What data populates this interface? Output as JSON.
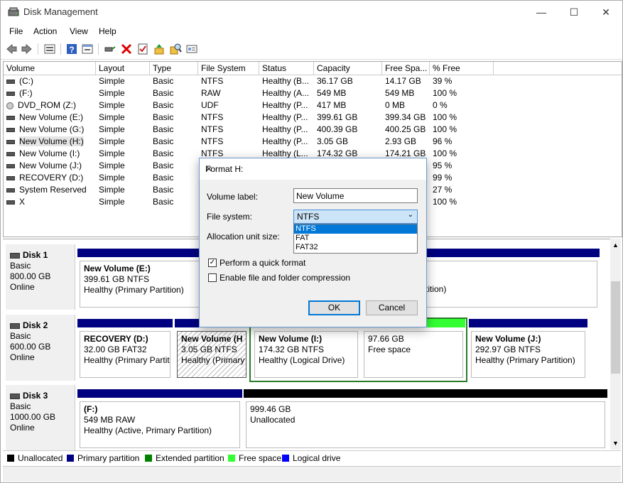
{
  "window": {
    "title": "Disk Management"
  },
  "menu": [
    "File",
    "Action",
    "View",
    "Help"
  ],
  "toolbar_icons": [
    "back-icon",
    "forward-icon",
    "disk-list-icon",
    "help-icon",
    "properties-icon",
    "connect-icon",
    "delete-icon",
    "check-icon",
    "import-icon",
    "search-icon",
    "settings-icon"
  ],
  "columns": [
    "Volume",
    "Layout",
    "Type",
    "File System",
    "Status",
    "Capacity",
    "Free Spa...",
    "% Free"
  ],
  "volumes": [
    {
      "name": "(C:)",
      "layout": "Simple",
      "type": "Basic",
      "fs": "NTFS",
      "status": "Healthy (B...",
      "capacity": "36.17 GB",
      "free": "14.17 GB",
      "pct": "39 %"
    },
    {
      "name": "(F:)",
      "layout": "Simple",
      "type": "Basic",
      "fs": "RAW",
      "status": "Healthy (A...",
      "capacity": "549 MB",
      "free": "549 MB",
      "pct": "100 %"
    },
    {
      "name": "DVD_ROM (Z:)",
      "layout": "Simple",
      "type": "Basic",
      "fs": "UDF",
      "status": "Healthy (P...",
      "capacity": "417 MB",
      "free": "0 MB",
      "pct": "0 %"
    },
    {
      "name": "New Volume (E:)",
      "layout": "Simple",
      "type": "Basic",
      "fs": "NTFS",
      "status": "Healthy (P...",
      "capacity": "399.61 GB",
      "free": "399.34 GB",
      "pct": "100 %"
    },
    {
      "name": "New Volume (G:)",
      "layout": "Simple",
      "type": "Basic",
      "fs": "NTFS",
      "status": "Healthy (P...",
      "capacity": "400.39 GB",
      "free": "400.25 GB",
      "pct": "100 %"
    },
    {
      "name": "New Volume (H:)",
      "layout": "Simple",
      "type": "Basic",
      "fs": "NTFS",
      "status": "Healthy (P...",
      "capacity": "3.05 GB",
      "free": "2.93 GB",
      "pct": "96 %"
    },
    {
      "name": "New Volume (I:)",
      "layout": "Simple",
      "type": "Basic",
      "fs": "NTFS",
      "status": "Healthy (L...",
      "capacity": "174.32 GB",
      "free": "174.21 GB",
      "pct": "100 %"
    },
    {
      "name": "New Volume (J:)",
      "layout": "Simple",
      "type": "Basic",
      "fs": "",
      "status": "",
      "capacity": "",
      "free": "",
      "pct": "95 %"
    },
    {
      "name": "RECOVERY (D:)",
      "layout": "Simple",
      "type": "Basic",
      "fs": "",
      "status": "",
      "capacity": "",
      "free": "",
      "pct": "99 %"
    },
    {
      "name": "System Reserved",
      "layout": "Simple",
      "type": "Basic",
      "fs": "",
      "status": "",
      "capacity": "",
      "free": "",
      "pct": "27 %"
    },
    {
      "name": "X",
      "layout": "Simple",
      "type": "Basic",
      "fs": "",
      "status": "",
      "capacity": "",
      "free": "",
      "pct": "100 %"
    }
  ],
  "disks": [
    {
      "name": "Disk 1",
      "type": "Basic",
      "size": "800.00 GB",
      "state": "Online",
      "partitions": [
        {
          "name": "New Volume  (E:)",
          "info": "399.61 GB NTFS",
          "status": "Healthy (Primary Partition)"
        },
        {
          "name": "",
          "info": "",
          "status": "rtition)"
        }
      ]
    },
    {
      "name": "Disk 2",
      "type": "Basic",
      "size": "600.00 GB",
      "state": "Online",
      "partitions": [
        {
          "name": "RECOVERY  (D:)",
          "info": "32.00 GB FAT32",
          "status": "Healthy (Primary Partit"
        },
        {
          "name": "New Volume  (H",
          "info": "3.05 GB NTFS",
          "status": "Healthy (Primary"
        },
        {
          "name": "New Volume  (I:)",
          "info": "174.32 GB NTFS",
          "status": "Healthy (Logical Drive)"
        },
        {
          "name": "",
          "info": "97.66 GB",
          "status": "Free space"
        },
        {
          "name": "New Volume  (J:)",
          "info": "292.97 GB NTFS",
          "status": "Healthy (Primary Partition)"
        }
      ]
    },
    {
      "name": "Disk 3",
      "type": "Basic",
      "size": "1000.00 GB",
      "state": "Online",
      "partitions": [
        {
          "name": "(F:)",
          "info": "549 MB RAW",
          "status": "Healthy (Active, Primary Partition)"
        },
        {
          "name": "",
          "info": "999.46 GB",
          "status": "Unallocated"
        }
      ]
    }
  ],
  "legend": [
    {
      "label": "Unallocated",
      "color": "#000000"
    },
    {
      "label": "Primary partition",
      "color": "#000080"
    },
    {
      "label": "Extended partition",
      "color": "#008000"
    },
    {
      "label": "Free space",
      "color": "#33ff33"
    },
    {
      "label": "Logical drive",
      "color": "#0000ff"
    }
  ],
  "dialog": {
    "title": "Format H:",
    "volume_label_label": "Volume label:",
    "volume_label_value": "New Volume",
    "fs_label": "File system:",
    "fs_value": "NTFS",
    "fs_options": [
      "NTFS",
      "FAT",
      "FAT32"
    ],
    "alloc_label": "Allocation unit size:",
    "quick_format": "Perform a quick format",
    "compression": "Enable file and folder compression",
    "ok": "OK",
    "cancel": "Cancel"
  },
  "colors": {
    "primary": "#000080",
    "logical": "#0000ff",
    "free": "#33ff33",
    "extended": "#008000",
    "unallocated": "#000000"
  }
}
